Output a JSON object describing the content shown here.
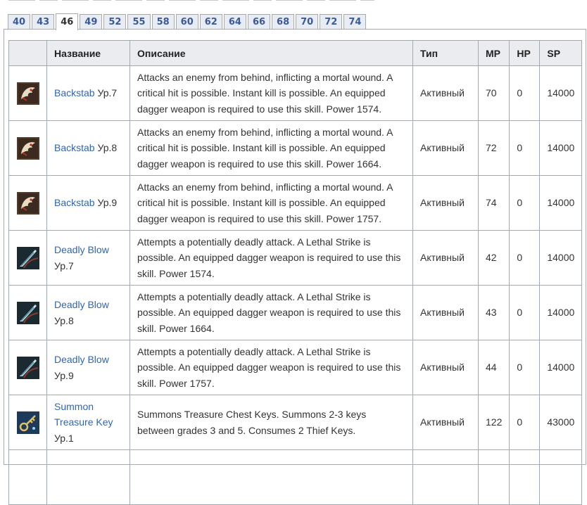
{
  "tabs": [
    "40",
    "43",
    "46",
    "49",
    "52",
    "55",
    "58",
    "60",
    "62",
    "64",
    "66",
    "68",
    "70",
    "72",
    "74"
  ],
  "active_tab": "46",
  "table": {
    "headers": [
      "",
      "Название",
      "Описание",
      "Тип",
      "MP",
      "HP",
      "SP"
    ],
    "rows": [
      {
        "icon": "backstab-icon",
        "name": "Backstab",
        "level": "Ур.7",
        "description": "Attacks an enemy from behind, inflicting a mortal wound. A critical hit is possible. Instant kill is possible. An equipped dagger weapon is required to use this skill. Power 1574.",
        "type": "Активный",
        "mp": "70",
        "hp": "0",
        "sp": "14000"
      },
      {
        "icon": "backstab-icon",
        "name": "Backstab",
        "level": "Ур.8",
        "description": "Attacks an enemy from behind, inflicting a mortal wound. A critical hit is possible. Instant kill is possible. An equipped dagger weapon is required to use this skill. Power 1664.",
        "type": "Активный",
        "mp": "72",
        "hp": "0",
        "sp": "14000"
      },
      {
        "icon": "backstab-icon",
        "name": "Backstab",
        "level": "Ур.9",
        "description": "Attacks an enemy from behind, inflicting a mortal wound. A critical hit is possible. Instant kill is possible. An equipped dagger weapon is required to use this skill. Power 1757.",
        "type": "Активный",
        "mp": "74",
        "hp": "0",
        "sp": "14000"
      },
      {
        "icon": "deadly-blow-icon",
        "name": "Deadly Blow",
        "level": "Ур.7",
        "description": "Attempts a potentially deadly attack. A Lethal Strike is possible. An equipped dagger weapon is required to use this skill. Power 1574.",
        "type": "Активный",
        "mp": "42",
        "hp": "0",
        "sp": "14000"
      },
      {
        "icon": "deadly-blow-icon",
        "name": "Deadly Blow",
        "level": "Ур.8",
        "description": "Attempts a potentially deadly attack. A Lethal Strike is possible. An equipped dagger weapon is required to use this skill. Power 1664.",
        "type": "Активный",
        "mp": "43",
        "hp": "0",
        "sp": "14000"
      },
      {
        "icon": "deadly-blow-icon",
        "name": "Deadly Blow",
        "level": "Ур.9",
        "description": "Attempts a potentially deadly attack. A Lethal Strike is possible. An equipped dagger weapon is required to use this skill. Power 1757.",
        "type": "Активный",
        "mp": "44",
        "hp": "0",
        "sp": "14000"
      },
      {
        "icon": "key-icon",
        "name": "Summon Treasure Key",
        "level": "Ур.1",
        "description": "Summons Treasure Chest Keys. Summons 2-3 keys between grades 3 and 5. Consumes 2 Thief Keys.",
        "type": "Активный",
        "mp": "122",
        "hp": "0",
        "sp": "43000"
      }
    ]
  },
  "colors": {
    "link": "#3366aa",
    "tab_text": "#3b5a99",
    "header_bg": "#eaecf0",
    "border": "#a2a9b1"
  }
}
